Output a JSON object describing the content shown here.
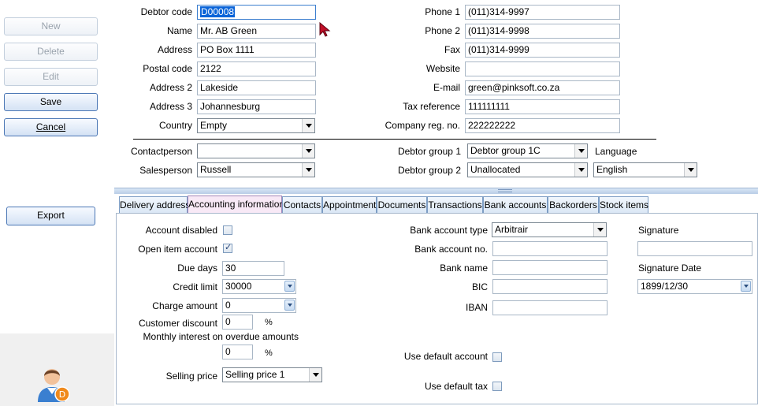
{
  "sidebar": {
    "buttons": {
      "new": "New",
      "delete": "Delete",
      "edit": "Edit",
      "save": "Save",
      "cancel": "Cancel",
      "export": "Export"
    },
    "avatar_badge": "D"
  },
  "form": {
    "debtor_code": {
      "label": "Debtor code",
      "value": "D00008"
    },
    "name": {
      "label": "Name",
      "value": "Mr. AB Green"
    },
    "address": {
      "label": "Address",
      "value": "PO Box 1111"
    },
    "postal_code": {
      "label": "Postal code",
      "value": "2122"
    },
    "address2": {
      "label": "Address 2",
      "value": "Lakeside"
    },
    "address3": {
      "label": "Address 3",
      "value": "Johannesburg"
    },
    "country": {
      "label": "Country",
      "value": "Empty"
    },
    "phone1": {
      "label": "Phone 1",
      "value": "(011)314-9997"
    },
    "phone2": {
      "label": "Phone 2",
      "value": "(011)314-9998"
    },
    "fax": {
      "label": "Fax",
      "value": "(011)314-9999"
    },
    "website": {
      "label": "Website",
      "value": ""
    },
    "email": {
      "label": "E-mail",
      "value": "green@pinksoft.co.za"
    },
    "tax_reference": {
      "label": "Tax reference",
      "value": "111111111"
    },
    "company_reg": {
      "label": "Company reg. no.",
      "value": "222222222"
    },
    "contactperson": {
      "label": "Contactperson",
      "value": ""
    },
    "salesperson": {
      "label": "Salesperson",
      "value": "Russell"
    },
    "debtor_group1": {
      "label": "Debtor group 1",
      "value": "Debtor group 1C"
    },
    "debtor_group2": {
      "label": "Debtor group 2",
      "value": "Unallocated"
    },
    "language": {
      "label": "Language",
      "value": "English"
    }
  },
  "tabs": [
    {
      "label": "Delivery address",
      "active": false
    },
    {
      "label": "Accounting information",
      "active": true
    },
    {
      "label": "Contacts",
      "active": false
    },
    {
      "label": "Appointment",
      "active": false
    },
    {
      "label": "Documents",
      "active": false
    },
    {
      "label": "Transactions",
      "active": false
    },
    {
      "label": "Bank accounts",
      "active": false
    },
    {
      "label": "Backorders",
      "active": false
    },
    {
      "label": "Stock items",
      "active": false
    }
  ],
  "accounting": {
    "account_disabled": {
      "label": "Account disabled",
      "checked": false
    },
    "open_item_account": {
      "label": "Open item account",
      "checked": true
    },
    "due_days": {
      "label": "Due days",
      "value": "30"
    },
    "credit_limit": {
      "label": "Credit limit",
      "value": "30000"
    },
    "charge_amount": {
      "label": "Charge amount",
      "value": "0"
    },
    "customer_discount": {
      "label": "Customer discount",
      "value": "0",
      "unit": "%"
    },
    "monthly_interest": {
      "label": "Monthly interest on overdue amounts",
      "value": "0",
      "unit": "%"
    },
    "selling_price": {
      "label": "Selling price",
      "value": "Selling price 1"
    },
    "bank_account_type": {
      "label": "Bank account type",
      "value": "Arbitrair"
    },
    "bank_account_no": {
      "label": "Bank account no.",
      "value": ""
    },
    "bank_name": {
      "label": "Bank name",
      "value": ""
    },
    "bic": {
      "label": "BIC",
      "value": ""
    },
    "iban": {
      "label": "IBAN",
      "value": ""
    },
    "use_default_account": {
      "label": "Use default account",
      "checked": false
    },
    "use_default_tax": {
      "label": "Use default tax",
      "checked": false
    },
    "signature": {
      "label": "Signature",
      "value": ""
    },
    "signature_date": {
      "label": "Signature Date",
      "value": "1899/12/30"
    }
  },
  "colors": {
    "selection": "#0a64d8",
    "active_tab": "#f8e9f6",
    "button_border": "#8aa6c8"
  }
}
